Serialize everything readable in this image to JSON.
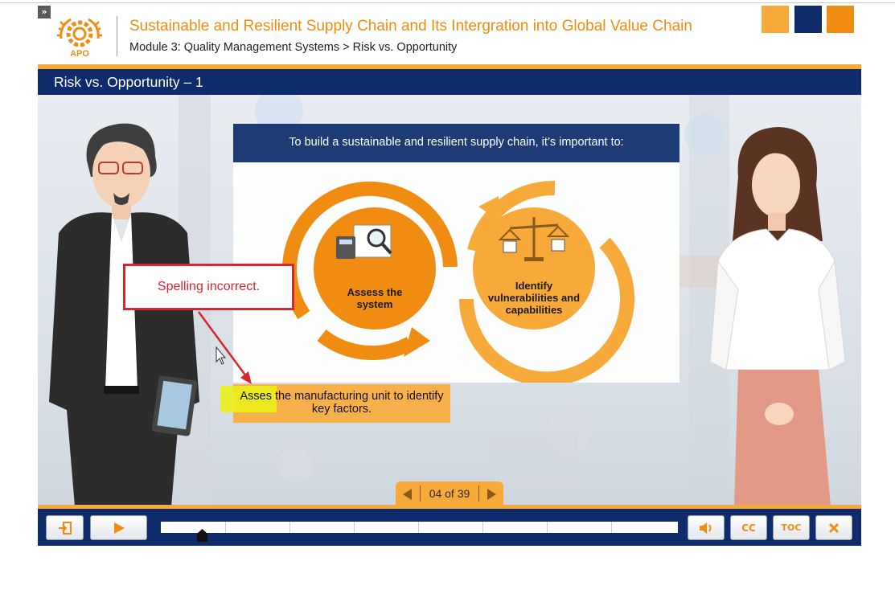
{
  "header": {
    "course_title": "Sustainable and Resilient Supply Chain and Its Intergration into Global Value Chain",
    "breadcrumb": "Module 3: Quality Management Systems > Risk vs. Opportunity",
    "logo_text": "APO",
    "collapse_label": "»"
  },
  "slide": {
    "title": "Risk vs. Opportunity – 1",
    "card_heading": "To build a sustainable and resilient supply chain, it’s important to:",
    "steps": [
      {
        "label": "Assess the system",
        "icon": "calculator-magnifier-icon"
      },
      {
        "label": "Identify vulnerabilities and capabilities",
        "icon": "balance-scale-icon"
      }
    ],
    "highlight_text": "Asses the manufacturing unit to identify key factors.",
    "annotation": "Spelling incorrect."
  },
  "pager": {
    "text": "04 of 39"
  },
  "controls": {
    "exit_icon": "exit-icon",
    "play_icon": "play-icon",
    "volume_icon": "volume-icon",
    "cc_label": "CC",
    "toc_label": "TOC",
    "close_icon": "close-icon",
    "progress_fraction": 0.08
  },
  "colors": {
    "navy": "#0e2c6b",
    "orange": "#f08c12",
    "light_orange": "#f7a93a",
    "annotation_red": "#d7262e"
  }
}
